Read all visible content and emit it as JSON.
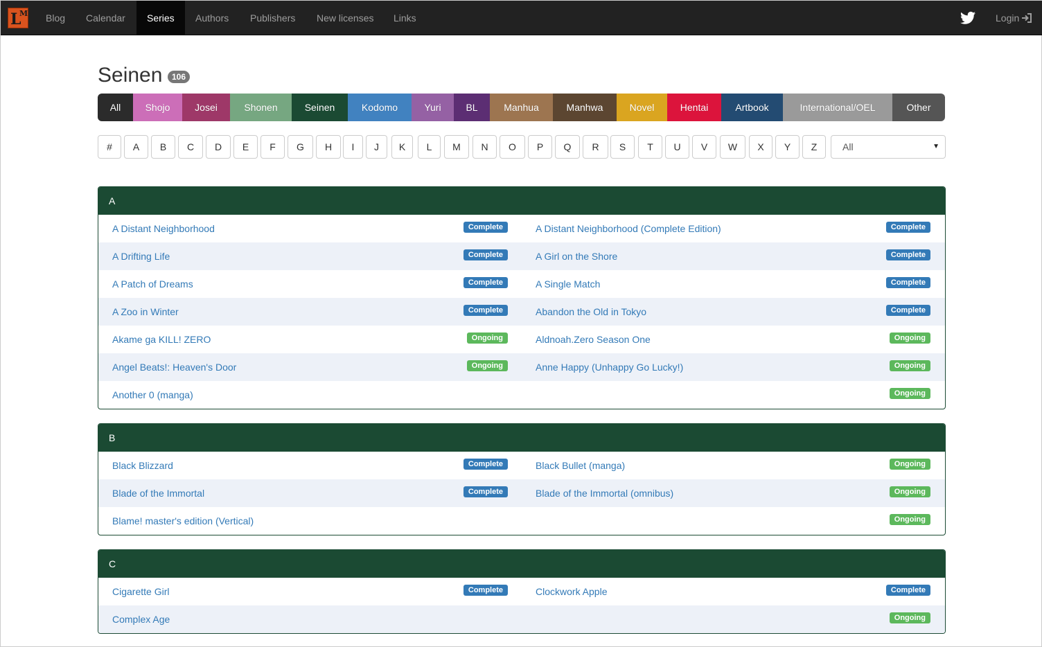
{
  "nav": {
    "logo_letters": [
      "L",
      "M"
    ],
    "links": [
      {
        "label": "Blog",
        "active": false
      },
      {
        "label": "Calendar",
        "active": false
      },
      {
        "label": "Series",
        "active": true
      },
      {
        "label": "Authors",
        "active": false
      },
      {
        "label": "Publishers",
        "active": false
      },
      {
        "label": "New licenses",
        "active": false
      },
      {
        "label": "Links",
        "active": false
      }
    ],
    "login_label": "Login",
    "twitter_icon": "twitter-icon",
    "login_icon": "sign-in-icon"
  },
  "page": {
    "title": "Seinen",
    "count": "106"
  },
  "categories": [
    {
      "label": "All",
      "color": "#2b2b2b"
    },
    {
      "label": "Shojo",
      "color": "#cc6eb8"
    },
    {
      "label": "Josei",
      "color": "#9e3868"
    },
    {
      "label": "Shonen",
      "color": "#76a781"
    },
    {
      "label": "Seinen",
      "color": "#1b4a33"
    },
    {
      "label": "Kodomo",
      "color": "#4182c0"
    },
    {
      "label": "Yuri",
      "color": "#9561a4"
    },
    {
      "label": "BL",
      "color": "#5c2e73"
    },
    {
      "label": "Manhua",
      "color": "#9d7550"
    },
    {
      "label": "Manhwa",
      "color": "#5c4631"
    },
    {
      "label": "Novel",
      "color": "#daa520"
    },
    {
      "label": "Hentai",
      "color": "#dc143c"
    },
    {
      "label": "Artbook",
      "color": "#234b72"
    },
    {
      "label": "International/OEL",
      "color": "#9a9a9a"
    },
    {
      "label": "Other",
      "color": "#555555"
    }
  ],
  "letters": [
    "#",
    "A",
    "B",
    "C",
    "D",
    "E",
    "F",
    "G",
    "H",
    "I",
    "J",
    "K",
    "L",
    "M",
    "N",
    "O",
    "P",
    "Q",
    "R",
    "S",
    "T",
    "U",
    "V",
    "W",
    "X",
    "Y",
    "Z"
  ],
  "filter_select": {
    "value": "All"
  },
  "status_colors": {
    "Complete": "#337ab7",
    "Ongoing": "#5cb85c"
  },
  "sections": [
    {
      "letter": "A",
      "series": [
        {
          "title": "A Distant Neighborhood",
          "status": "Complete"
        },
        {
          "title": "A Distant Neighborhood (Complete Edition)",
          "status": "Complete"
        },
        {
          "title": "A Drifting Life",
          "status": "Complete"
        },
        {
          "title": "A Girl on the Shore",
          "status": "Complete"
        },
        {
          "title": "A Patch of Dreams",
          "status": "Complete"
        },
        {
          "title": "A Single Match",
          "status": "Complete"
        },
        {
          "title": "A Zoo in Winter",
          "status": "Complete"
        },
        {
          "title": "Abandon the Old in Tokyo",
          "status": "Complete"
        },
        {
          "title": "Akame ga KILL! ZERO",
          "status": "Ongoing"
        },
        {
          "title": "Aldnoah.Zero Season One",
          "status": "Ongoing"
        },
        {
          "title": "Angel Beats!: Heaven's Door",
          "status": "Ongoing"
        },
        {
          "title": "Anne Happy (Unhappy Go Lucky!)",
          "status": "Ongoing"
        },
        {
          "title": "Another 0 (manga)",
          "status": "Ongoing"
        }
      ]
    },
    {
      "letter": "B",
      "series": [
        {
          "title": "Black Blizzard",
          "status": "Complete"
        },
        {
          "title": "Black Bullet (manga)",
          "status": "Ongoing"
        },
        {
          "title": "Blade of the Immortal",
          "status": "Complete"
        },
        {
          "title": "Blade of the Immortal (omnibus)",
          "status": "Ongoing"
        },
        {
          "title": "Blame! master's edition (Vertical)",
          "status": "Ongoing"
        }
      ]
    },
    {
      "letter": "C",
      "series": [
        {
          "title": "Cigarette Girl",
          "status": "Complete"
        },
        {
          "title": "Clockwork Apple",
          "status": "Complete"
        },
        {
          "title": "Complex Age",
          "status": "Ongoing"
        }
      ]
    }
  ]
}
